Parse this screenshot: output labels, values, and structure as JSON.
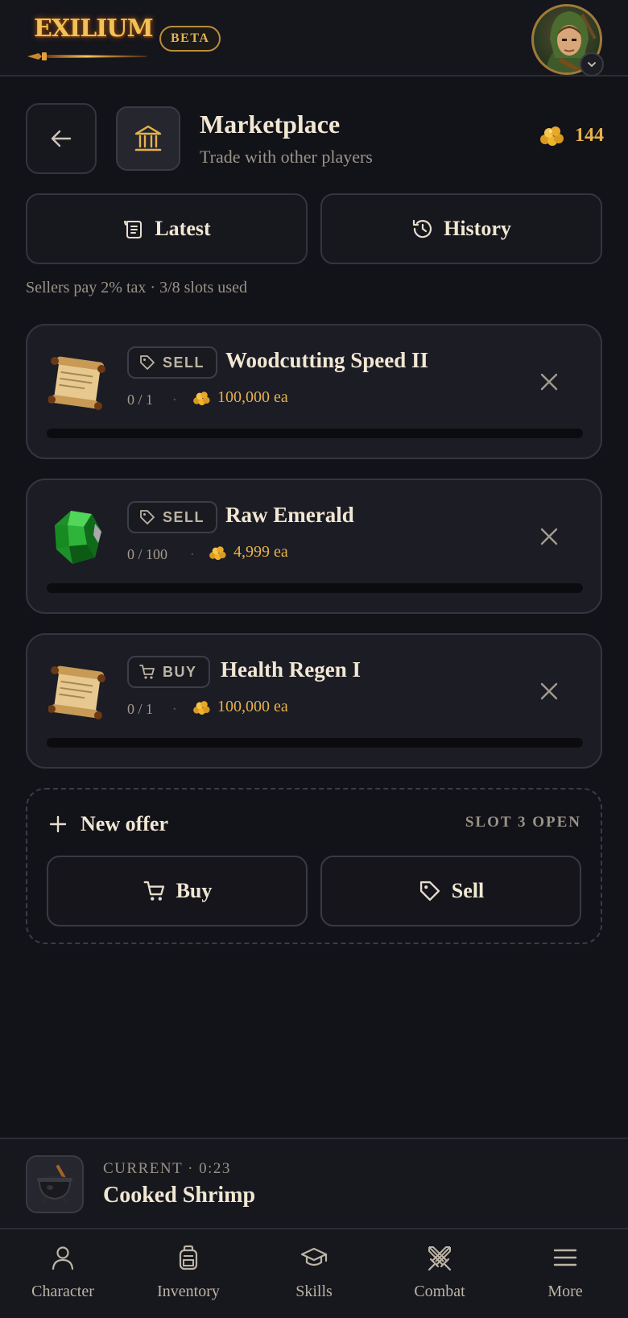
{
  "app": {
    "logo_text": "EXILIUM",
    "badge": "BETA"
  },
  "header": {
    "title": "Marketplace",
    "subtitle": "Trade with other players",
    "gold": "144"
  },
  "tabs": [
    {
      "label": "Latest",
      "icon": "scroll-icon"
    },
    {
      "label": "History",
      "icon": "history-icon"
    }
  ],
  "tax_note": "Sellers pay 2% tax · 3/8 slots used",
  "offers": [
    {
      "type": "SELL",
      "item_icon": "scroll",
      "name": "Woodcutting Speed II",
      "quantity": "0 / 1",
      "price": "100,000 ea",
      "progress": 0
    },
    {
      "type": "SELL",
      "item_icon": "emerald",
      "name": "Raw Emerald",
      "quantity": "0 / 100",
      "price": "4,999 ea",
      "progress": 0
    },
    {
      "type": "BUY",
      "item_icon": "scroll",
      "name": "Health Regen I",
      "quantity": "0 / 1",
      "price": "100,000 ea",
      "progress": 0
    }
  ],
  "new_offer": {
    "title": "New offer",
    "slot_status": "SLOT 3 OPEN",
    "buy_label": "Buy",
    "sell_label": "Sell"
  },
  "current": {
    "label": "CURRENT · 0:23",
    "name": "Cooked Shrimp",
    "icon": "cauldron"
  },
  "nav": [
    {
      "label": "Character",
      "icon": "person-icon"
    },
    {
      "label": "Inventory",
      "icon": "backpack-icon"
    },
    {
      "label": "Skills",
      "icon": "graduation-cap-icon"
    },
    {
      "label": "Combat",
      "icon": "crossed-swords-icon"
    },
    {
      "label": "More",
      "icon": "menu-icon"
    }
  ],
  "colors": {
    "background": "#121219",
    "card": "#1c1c25",
    "gold": "#e7b24b",
    "text": "#f1e7d2",
    "muted": "#9b9386"
  }
}
